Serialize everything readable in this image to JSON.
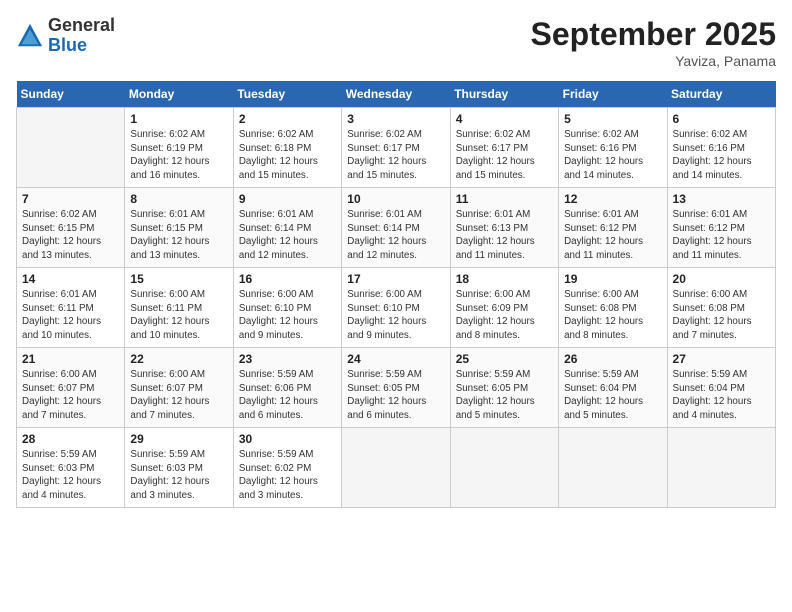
{
  "header": {
    "logo_general": "General",
    "logo_blue": "Blue",
    "month": "September 2025",
    "location": "Yaviza, Panama"
  },
  "days_of_week": [
    "Sunday",
    "Monday",
    "Tuesday",
    "Wednesday",
    "Thursday",
    "Friday",
    "Saturday"
  ],
  "weeks": [
    [
      {
        "day": "",
        "info": ""
      },
      {
        "day": "1",
        "info": "Sunrise: 6:02 AM\nSunset: 6:19 PM\nDaylight: 12 hours\nand 16 minutes."
      },
      {
        "day": "2",
        "info": "Sunrise: 6:02 AM\nSunset: 6:18 PM\nDaylight: 12 hours\nand 15 minutes."
      },
      {
        "day": "3",
        "info": "Sunrise: 6:02 AM\nSunset: 6:17 PM\nDaylight: 12 hours\nand 15 minutes."
      },
      {
        "day": "4",
        "info": "Sunrise: 6:02 AM\nSunset: 6:17 PM\nDaylight: 12 hours\nand 15 minutes."
      },
      {
        "day": "5",
        "info": "Sunrise: 6:02 AM\nSunset: 6:16 PM\nDaylight: 12 hours\nand 14 minutes."
      },
      {
        "day": "6",
        "info": "Sunrise: 6:02 AM\nSunset: 6:16 PM\nDaylight: 12 hours\nand 14 minutes."
      }
    ],
    [
      {
        "day": "7",
        "info": "Sunrise: 6:02 AM\nSunset: 6:15 PM\nDaylight: 12 hours\nand 13 minutes."
      },
      {
        "day": "8",
        "info": "Sunrise: 6:01 AM\nSunset: 6:15 PM\nDaylight: 12 hours\nand 13 minutes."
      },
      {
        "day": "9",
        "info": "Sunrise: 6:01 AM\nSunset: 6:14 PM\nDaylight: 12 hours\nand 12 minutes."
      },
      {
        "day": "10",
        "info": "Sunrise: 6:01 AM\nSunset: 6:14 PM\nDaylight: 12 hours\nand 12 minutes."
      },
      {
        "day": "11",
        "info": "Sunrise: 6:01 AM\nSunset: 6:13 PM\nDaylight: 12 hours\nand 11 minutes."
      },
      {
        "day": "12",
        "info": "Sunrise: 6:01 AM\nSunset: 6:12 PM\nDaylight: 12 hours\nand 11 minutes."
      },
      {
        "day": "13",
        "info": "Sunrise: 6:01 AM\nSunset: 6:12 PM\nDaylight: 12 hours\nand 11 minutes."
      }
    ],
    [
      {
        "day": "14",
        "info": "Sunrise: 6:01 AM\nSunset: 6:11 PM\nDaylight: 12 hours\nand 10 minutes."
      },
      {
        "day": "15",
        "info": "Sunrise: 6:00 AM\nSunset: 6:11 PM\nDaylight: 12 hours\nand 10 minutes."
      },
      {
        "day": "16",
        "info": "Sunrise: 6:00 AM\nSunset: 6:10 PM\nDaylight: 12 hours\nand 9 minutes."
      },
      {
        "day": "17",
        "info": "Sunrise: 6:00 AM\nSunset: 6:10 PM\nDaylight: 12 hours\nand 9 minutes."
      },
      {
        "day": "18",
        "info": "Sunrise: 6:00 AM\nSunset: 6:09 PM\nDaylight: 12 hours\nand 8 minutes."
      },
      {
        "day": "19",
        "info": "Sunrise: 6:00 AM\nSunset: 6:08 PM\nDaylight: 12 hours\nand 8 minutes."
      },
      {
        "day": "20",
        "info": "Sunrise: 6:00 AM\nSunset: 6:08 PM\nDaylight: 12 hours\nand 7 minutes."
      }
    ],
    [
      {
        "day": "21",
        "info": "Sunrise: 6:00 AM\nSunset: 6:07 PM\nDaylight: 12 hours\nand 7 minutes."
      },
      {
        "day": "22",
        "info": "Sunrise: 6:00 AM\nSunset: 6:07 PM\nDaylight: 12 hours\nand 7 minutes."
      },
      {
        "day": "23",
        "info": "Sunrise: 5:59 AM\nSunset: 6:06 PM\nDaylight: 12 hours\nand 6 minutes."
      },
      {
        "day": "24",
        "info": "Sunrise: 5:59 AM\nSunset: 6:05 PM\nDaylight: 12 hours\nand 6 minutes."
      },
      {
        "day": "25",
        "info": "Sunrise: 5:59 AM\nSunset: 6:05 PM\nDaylight: 12 hours\nand 5 minutes."
      },
      {
        "day": "26",
        "info": "Sunrise: 5:59 AM\nSunset: 6:04 PM\nDaylight: 12 hours\nand 5 minutes."
      },
      {
        "day": "27",
        "info": "Sunrise: 5:59 AM\nSunset: 6:04 PM\nDaylight: 12 hours\nand 4 minutes."
      }
    ],
    [
      {
        "day": "28",
        "info": "Sunrise: 5:59 AM\nSunset: 6:03 PM\nDaylight: 12 hours\nand 4 minutes."
      },
      {
        "day": "29",
        "info": "Sunrise: 5:59 AM\nSunset: 6:03 PM\nDaylight: 12 hours\nand 3 minutes."
      },
      {
        "day": "30",
        "info": "Sunrise: 5:59 AM\nSunset: 6:02 PM\nDaylight: 12 hours\nand 3 minutes."
      },
      {
        "day": "",
        "info": ""
      },
      {
        "day": "",
        "info": ""
      },
      {
        "day": "",
        "info": ""
      },
      {
        "day": "",
        "info": ""
      }
    ]
  ]
}
